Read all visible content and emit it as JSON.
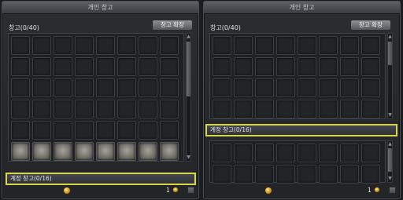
{
  "left_window": {
    "title": "개인 창고",
    "storage_label": "창고(0/40)",
    "expand_button": "창고 확장",
    "account_storage_label": "계정 창고(0/16)",
    "footer_amount": "1"
  },
  "right_window": {
    "title": "개인 창고",
    "storage_label": "창고(0/40)",
    "expand_button": "창고 확장",
    "account_storage_label": "계정 창고(0/16)",
    "footer_amount": "1"
  },
  "icons": {
    "coin": "gold-coin-icon",
    "scroll_up": "▲",
    "scroll_down": "▼"
  },
  "colors": {
    "highlight_border": "#d6d64a",
    "panel_bg": "#26282c"
  }
}
